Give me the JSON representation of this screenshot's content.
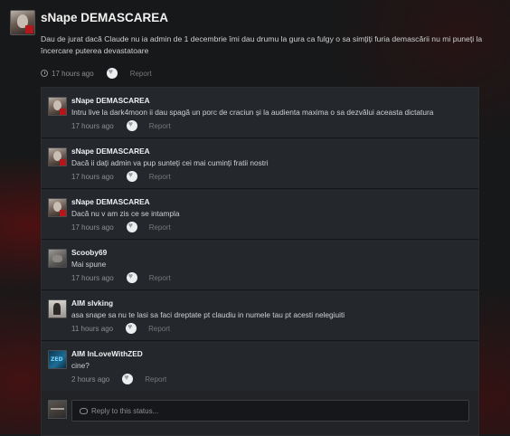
{
  "status": {
    "author": "sNape DEMASCAREA",
    "text": "Dau de jurat dacă Claude nu ia admin de 1 decembrie îmi dau drumu la gura ca fulgy o sa simțiți furia demascării nu mi puneți la încercare puterea devastatoare",
    "time": "17 hours ago",
    "report": "Report"
  },
  "comments": [
    {
      "author": "sNape DEMASCAREA",
      "text": "Intru live la dark4moon ii dau spagă un porc de craciun și la audienta maxima o sa dezvălui aceasta dictatura",
      "time": "17 hours ago",
      "report": "Report",
      "avatar": "snape-avatar"
    },
    {
      "author": "sNape DEMASCAREA",
      "text": "Dacă ii dați admin va pup sunteți cei mai cuminți fratii nostri",
      "time": "17 hours ago",
      "report": "Report",
      "avatar": "snape-avatar"
    },
    {
      "author": "sNape DEMASCAREA",
      "text": "Dacă nu v am zis ce se intampla",
      "time": "17 hours ago",
      "report": "Report",
      "avatar": "snape-avatar"
    },
    {
      "author": "Scooby69",
      "text": "Mai spune",
      "time": "17 hours ago",
      "report": "Report",
      "avatar": "scooby-avatar"
    },
    {
      "author": "AIM slvking",
      "text": "asa snape sa nu te lasi sa faci dreptate pt claudiu in numele tau pt acesti nelegiuiti",
      "time": "11 hours ago",
      "report": "Report",
      "avatar": "aim-avatar"
    },
    {
      "author": "AIM InLoveWithZED",
      "text": "cine?",
      "time": "2 hours ago",
      "report": "Report",
      "avatar": "zed-avatar"
    }
  ],
  "reply": {
    "placeholder": "Reply to this status..."
  },
  "icons": {
    "clock": "clock-icon",
    "like": "heart-like-icon",
    "reply": "speech-bubble-icon"
  }
}
